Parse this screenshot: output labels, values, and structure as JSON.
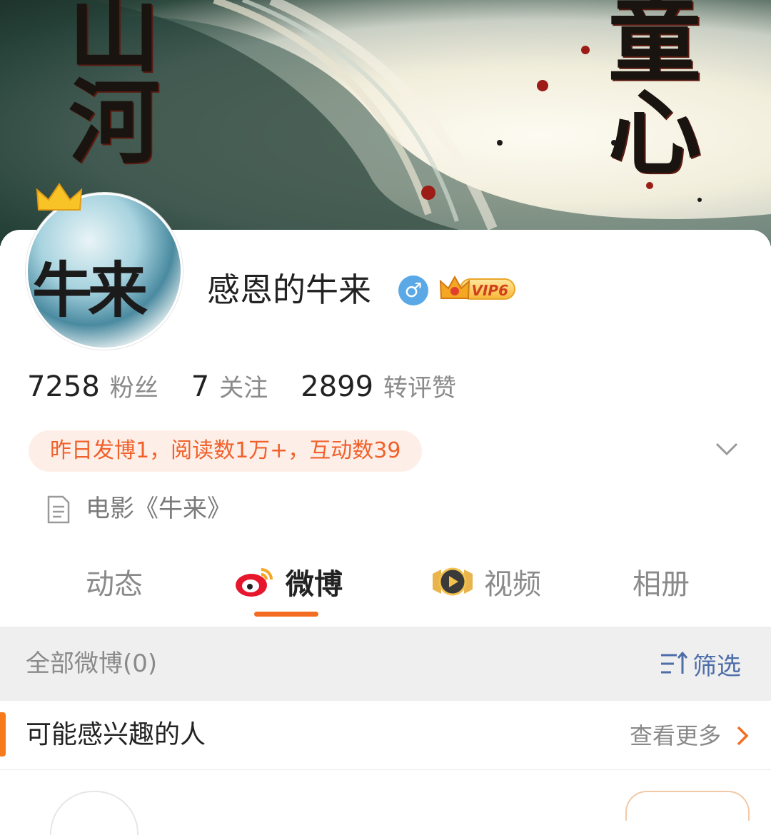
{
  "banner": {
    "left_chars": [
      "山",
      "河"
    ],
    "right_chars": [
      "童",
      "心"
    ]
  },
  "profile": {
    "avatar_text": "牛来",
    "username": "感恩的牛来",
    "gender_symbol": "♂",
    "vip_label": "VIP6"
  },
  "stats": [
    {
      "value": "7258",
      "label": "粉丝"
    },
    {
      "value": "7",
      "label": "关注"
    },
    {
      "value": "2899",
      "label": "转评赞"
    }
  ],
  "activity_summary": "昨日发博1，阅读数1万+，互动数39",
  "intro": "电影《牛来》",
  "tabs": [
    {
      "label": "动态",
      "active": false
    },
    {
      "label": "微博",
      "active": true
    },
    {
      "label": "视频",
      "active": false
    },
    {
      "label": "相册",
      "active": false
    }
  ],
  "feed": {
    "all_label": "全部微博(0)",
    "filter_label": "筛选"
  },
  "suggestions": {
    "title": "可能感兴趣的人",
    "see_more": "查看更多"
  },
  "colors": {
    "accent_orange": "#f36c21",
    "filter_blue": "#4d6ea8",
    "activity_text": "#f0612b",
    "activity_bg": "#fdefe8"
  }
}
